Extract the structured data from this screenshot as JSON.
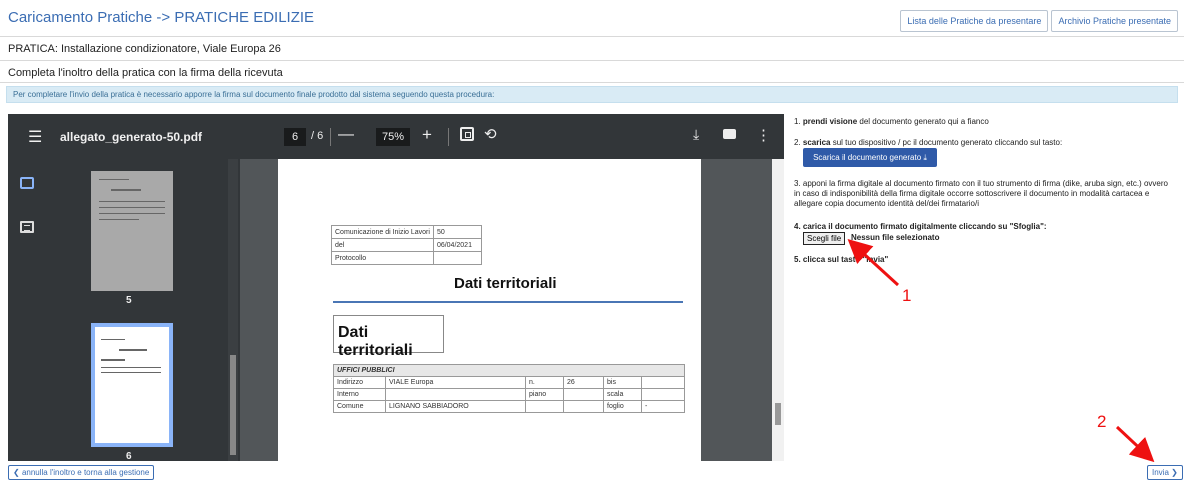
{
  "header": {
    "title": "Caricamento Pratiche -> PRATICHE EDILIZIE",
    "btn_list": "Lista delle Pratiche da presentare",
    "btn_archive": "Archivio Pratiche presentate"
  },
  "pratica": "PRATICA: Installazione condizionatore, Viale Europa 26",
  "completa": "Completa l'inoltro della pratica con la firma della ricevuta",
  "info": "Per completare l'invio della pratica è necessario apporre la firma sul documento finale prodotto dal sistema seguendo questa procedura:",
  "viewer": {
    "filename": "allegato_generato-50.pdf",
    "page_current": "6",
    "page_total": "/ 6",
    "zoom": "75%",
    "icons": [
      "menu-icon",
      "minus-icon",
      "plus-icon",
      "fit-page-icon",
      "rotate-icon",
      "download-icon",
      "print-icon",
      "more-icon",
      "thumbnail-icon",
      "outline-icon"
    ],
    "thumbs": [
      {
        "label": "5"
      },
      {
        "label": "6"
      }
    ]
  },
  "doc": {
    "table1": [
      [
        "Comunicazione di Inizio Lavori",
        "50"
      ],
      [
        "del",
        "06/04/2021"
      ],
      [
        "Protocollo",
        ""
      ]
    ],
    "heading": "Dati territoriali",
    "box_heading": "Dati territoriali",
    "table2_header": "UFFICI PUBBLICI",
    "table2": [
      [
        "Indirizzo",
        "VIALE Europa",
        "n.",
        "26",
        "bis",
        ""
      ],
      [
        "Interno",
        "",
        "piano",
        "",
        "scala",
        ""
      ],
      [
        "Comune",
        "LIGNANO SABBIADORO",
        "",
        "",
        "foglio",
        "-"
      ]
    ]
  },
  "instructions": {
    "s1_num": "1.",
    "s1_bold": "prendi visione",
    "s1_rest": "del documento generato qui a fianco",
    "s2_num": "2.",
    "s2_bold": "scarica",
    "s2_rest": "sul tuo dispositivo / pc il documento generato cliccando sul tasto:",
    "download_btn": "Scarica il documento generato",
    "s3": "3. apponi la firma digitale al documento firmato con il tuo strumento di firma (dike, aruba sign, etc.) ovvero in caso di indisponibilità della firma digitale occorre sottoscrivere il documento in modalità cartacea e allegare copia documento identità del/dei firmatario/i",
    "s4": "4. carica il documento firmato digitalmente cliccando su \"Sfoglia\":",
    "file_btn": "Scegli file",
    "file_status": "Nessun file selezionato",
    "s5": "5. clicca sul tasto \"Invia\""
  },
  "annotations": {
    "n1": "1",
    "n2": "2",
    "color": "#e11111"
  },
  "footer": {
    "back": "annulla l'inoltro e torna alla gestione",
    "send": "Invia"
  }
}
